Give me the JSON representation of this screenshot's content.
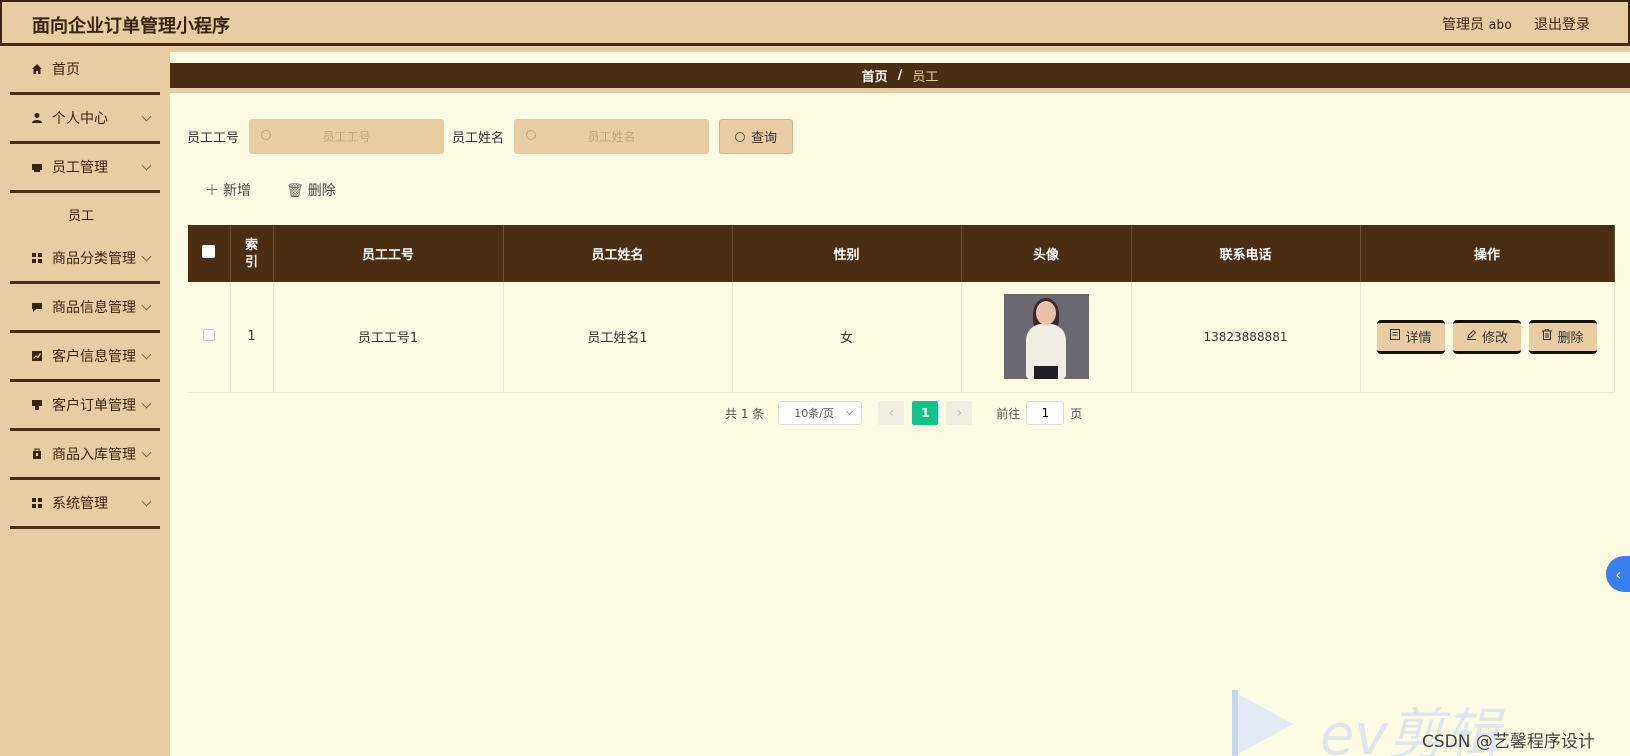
{
  "header": {
    "app_title": "面向企业订单管理小程序",
    "role_label": "管理员",
    "username": "abo",
    "logout_label": "退出登录"
  },
  "sidebar": {
    "items": [
      {
        "label": "首页",
        "icon": "home-icon"
      },
      {
        "label": "个人中心",
        "icon": "user-icon"
      },
      {
        "label": "员工管理",
        "icon": "folder-icon"
      },
      {
        "label": "员工",
        "icon": ""
      },
      {
        "label": "商品分类管理",
        "icon": "grid-icon"
      },
      {
        "label": "商品信息管理",
        "icon": "message-icon"
      },
      {
        "label": "客户信息管理",
        "icon": "chart-icon"
      },
      {
        "label": "客户订单管理",
        "icon": "clipboard-icon"
      },
      {
        "label": "商品入库管理",
        "icon": "bag-icon"
      },
      {
        "label": "系统管理",
        "icon": "grid-icon"
      }
    ]
  },
  "breadcrumb": {
    "home": "首页",
    "separator": "/",
    "current": "员工"
  },
  "search": {
    "id_label": "员工工号",
    "id_placeholder": "员工工号",
    "name_label": "员工姓名",
    "name_placeholder": "员工姓名",
    "query_label": "查询"
  },
  "actions": {
    "add_label": "新增",
    "delete_label": "删除"
  },
  "table": {
    "headers": [
      "索引",
      "员工工号",
      "员工姓名",
      "性别",
      "头像",
      "联系电话",
      "操作"
    ],
    "rows": [
      {
        "index": "1",
        "emp_id": "员工工号1",
        "emp_name": "员工姓名1",
        "gender": "女",
        "phone": "13823888881"
      }
    ],
    "row_actions": {
      "detail": "详情",
      "edit": "修改",
      "delete": "删除"
    }
  },
  "pagination": {
    "total_text": "共 1 条",
    "page_size": "10条/页",
    "current_page": "1",
    "goto_label": "前往",
    "goto_value": "1",
    "page_unit": "页"
  },
  "watermark": {
    "brand": "ev剪辑",
    "csdn": "CSDN @艺馨程序设计"
  },
  "colors": {
    "header_bg": "#e8cca4",
    "dark_brown": "#4b2d14",
    "page_bg": "#fdfbe4",
    "active_page": "#13c28a"
  }
}
